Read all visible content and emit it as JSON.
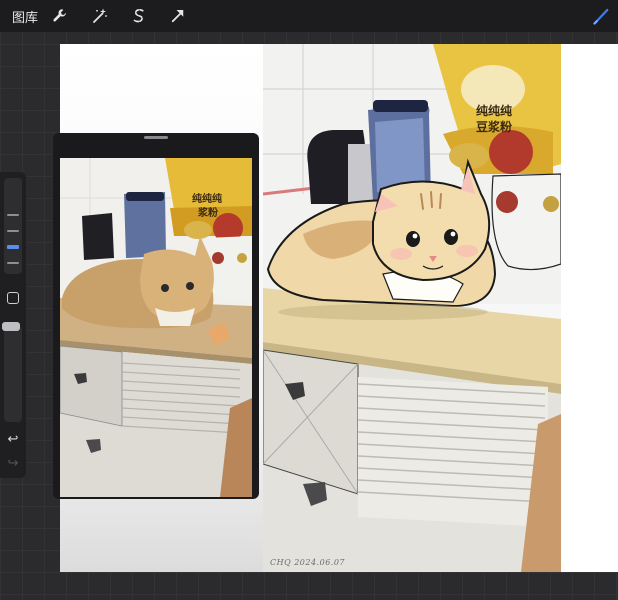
{
  "toolbar": {
    "gallery_label": "图库",
    "tools": [
      {
        "name": "actions",
        "icon": "wrench-icon"
      },
      {
        "name": "adjustments",
        "icon": "magic-wand-icon"
      },
      {
        "name": "selection",
        "icon": "selection-s-icon"
      },
      {
        "name": "transform",
        "icon": "arrow-cursor-icon"
      }
    ],
    "brush": {
      "icon": "brush-icon",
      "accent": "#3f7bf0"
    }
  },
  "sidebar": {
    "size_level": 0.55,
    "opacity_level": 0.0,
    "undo_icon": "undo-icon",
    "redo_icon": "redo-icon",
    "modify_icon": "square-icon"
  },
  "painting": {
    "signature": "CHQ 2024.06.07",
    "package_line1": "纯纯纯",
    "package_line2": "豆浆粉"
  },
  "reference": {
    "package_line1": "纯纯纯",
    "package_line2": "浆粉"
  }
}
